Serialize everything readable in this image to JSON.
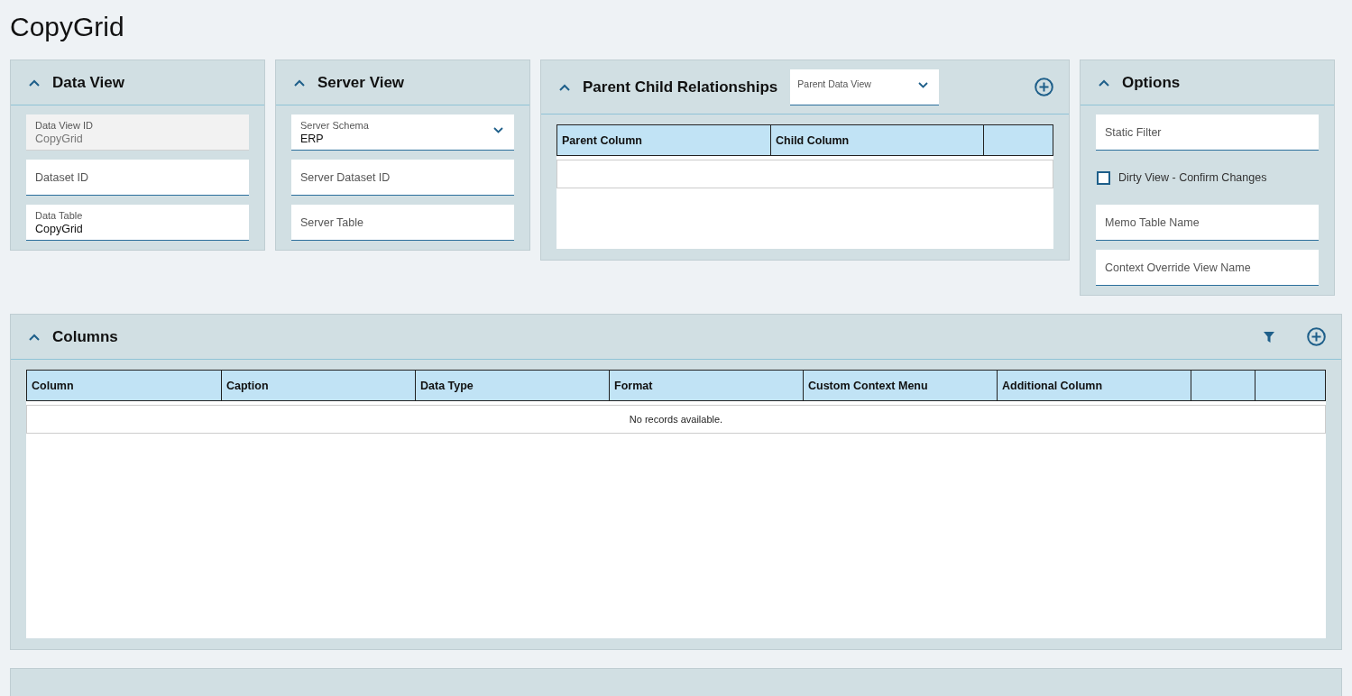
{
  "page_title": "CopyGrid",
  "panels": [
    {
      "title": "Data View",
      "expanded": true,
      "fields": [
        {
          "kind": "text",
          "label": "Data View ID",
          "value": "CopyGrid",
          "disabled": true
        },
        {
          "kind": "text",
          "label": "Dataset ID",
          "disabled": false
        },
        {
          "kind": "text",
          "label": "Data Table",
          "value": "CopyGrid",
          "disabled": false
        }
      ]
    },
    {
      "title": "Server View",
      "expanded": true,
      "fields": [
        {
          "kind": "select",
          "label": "Server Schema",
          "value": "ERP",
          "disabled": false
        },
        {
          "kind": "text",
          "label": "Server Dataset ID",
          "disabled": false
        },
        {
          "kind": "text",
          "label": "Server Table",
          "disabled": false
        }
      ]
    }
  ],
  "relationships": {
    "title": "Parent Child Relationships",
    "expanded": true,
    "dropdown": {
      "label": "Parent Data View"
    },
    "columns": [
      "Parent Column",
      "Child Column",
      ""
    ]
  },
  "options": {
    "title": "Options",
    "expanded": true,
    "items": [
      {
        "kind": "text",
        "label": "Static Filter"
      },
      {
        "kind": "checkbox",
        "label": "Dirty View - Confirm Changes",
        "checked": false
      },
      {
        "kind": "text",
        "label": "Memo Table Name"
      },
      {
        "kind": "text",
        "label": "Context Override View Name"
      }
    ]
  },
  "columns_panel": {
    "title": "Columns",
    "expanded": true,
    "columns": [
      "Column",
      "Caption",
      "Data Type",
      "Format",
      "Custom Context Menu",
      "Additional Column",
      "",
      ""
    ],
    "empty_message": "No records available."
  }
}
